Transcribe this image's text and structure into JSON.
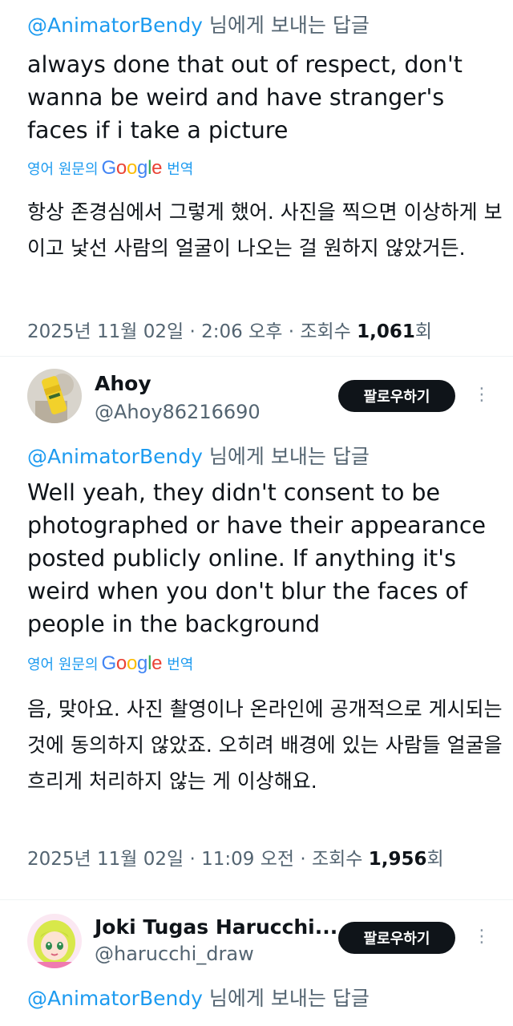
{
  "colors": {
    "accent": "#1d9bf0",
    "text": "#0f1419",
    "secondary": "#536471",
    "button_bg": "#0f1419"
  },
  "tweet1": {
    "reply_mention": "@AnimatorBendy",
    "reply_suffix": " 님에게 보내는 답글",
    "text": "always done that out of respect, don't wanna be weird and have stranger's faces if i take a picture",
    "translate_prefix": "영어 원문의",
    "translate_brand": "Google",
    "translate_suffix": "번역",
    "translated": "항상 존경심에서 그렇게 했어. 사진을 찍으면 이상하게 보이고 낯선 사람의 얼굴이 나오는 걸 원하지 않았거든.",
    "timestamp": "2025년 11월 02일 · 2:06 오후 · 조회수 ",
    "views": "1,061",
    "views_suffix": "회"
  },
  "tweet2": {
    "name": "Ahoy",
    "handle": "@Ahoy86216690",
    "follow": "팔로우하기",
    "more": "⋮",
    "avatar_icon": "yellow-can-avatar",
    "reply_mention": "@AnimatorBendy",
    "reply_suffix": " 님에게 보내는 답글",
    "text": "Well yeah, they didn't consent to be photographed or have their appearance posted publicly online. If anything it's weird when you don't blur the faces of people in the background",
    "translate_prefix": "영어 원문의",
    "translate_brand": "Google",
    "translate_suffix": "번역",
    "translated": "음, 맞아요. 사진 촬영이나 온라인에 공개적으로 게시되는 것에 동의하지 않았죠. 오히려 배경에 있는 사람들 얼굴을 흐리게 처리하지 않는 게 이상해요.",
    "timestamp": "2025년 11월 02일 · 11:09 오전 · 조회수 ",
    "views": "1,956",
    "views_suffix": "회"
  },
  "tweet3": {
    "name": "Joki Tugas Harucchi...",
    "handle": "@harucchi_draw",
    "follow": "팔로우하기",
    "more": "⋮",
    "avatar_icon": "anime-girl-avatar",
    "reply_mention": "@AnimatorBendy",
    "reply_suffix": " 님에게 보내는 답글"
  }
}
